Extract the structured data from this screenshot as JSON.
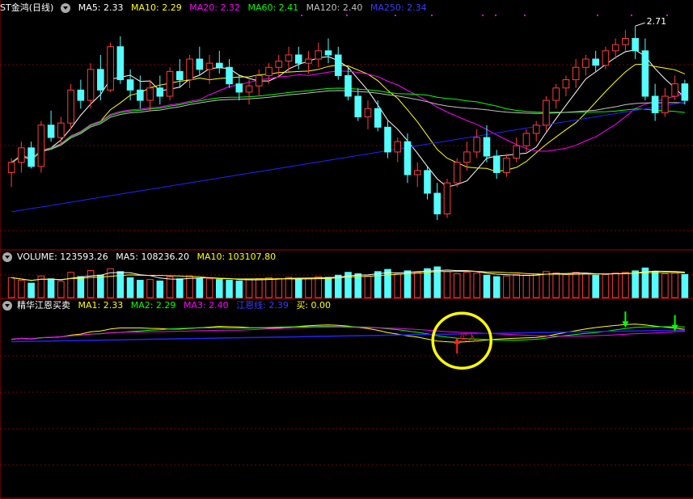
{
  "header_main": {
    "title": "ST金鸿(日线)",
    "ma5": "MA5: 2.33",
    "ma10": "MA10: 2.29",
    "ma20": "MA20: 2.32",
    "ma60": "MA60: 2.41",
    "ma120": "MA120: 2.40",
    "ma250": "MA250: 2.34"
  },
  "header_volume": {
    "volume": "VOLUME: 123593.26",
    "ma5": "MA5: 108236.20",
    "ma10": "MA10: 103107.80"
  },
  "header_indicator": {
    "name": "精华江恩买卖",
    "ma1": "MA1: 2.33",
    "ma2": "MA2: 2.29",
    "ma3": "MA3: 2.40",
    "gann": "江恩线: 2.39",
    "buy": "买: 0.00"
  },
  "colors": {
    "up": "#ff3c3c",
    "down": "#54fcfc",
    "ma5": "#ffffff",
    "ma10": "#ffff00",
    "ma20": "#ff00ff",
    "ma60": "#00ff00",
    "ma120": "#c0c0c0",
    "ma250": "#2222ff",
    "grid": "#7a0000",
    "highlight": "#ffff00"
  },
  "chart_data": [
    {
      "type": "candlestick",
      "panel": "price",
      "high_label": "2.71",
      "yrange": [
        1.75,
        2.8
      ],
      "candles": [
        [
          2.05,
          2.12,
          1.98,
          2.1
        ],
        [
          2.1,
          2.2,
          2.05,
          2.17
        ],
        [
          2.17,
          2.2,
          2.07,
          2.08
        ],
        [
          2.08,
          2.3,
          2.05,
          2.28
        ],
        [
          2.28,
          2.35,
          2.2,
          2.22
        ],
        [
          2.22,
          2.32,
          2.18,
          2.29
        ],
        [
          2.29,
          2.48,
          2.26,
          2.45
        ],
        [
          2.45,
          2.5,
          2.36,
          2.4
        ],
        [
          2.4,
          2.58,
          2.36,
          2.55
        ],
        [
          2.55,
          2.62,
          2.4,
          2.45
        ],
        [
          2.45,
          2.68,
          2.44,
          2.66
        ],
        [
          2.66,
          2.71,
          2.48,
          2.5
        ],
        [
          2.5,
          2.55,
          2.4,
          2.45
        ],
        [
          2.45,
          2.52,
          2.36,
          2.4
        ],
        [
          2.4,
          2.5,
          2.35,
          2.46
        ],
        [
          2.46,
          2.52,
          2.38,
          2.42
        ],
        [
          2.42,
          2.56,
          2.4,
          2.54
        ],
        [
          2.54,
          2.6,
          2.46,
          2.5
        ],
        [
          2.5,
          2.62,
          2.46,
          2.6
        ],
        [
          2.6,
          2.66,
          2.52,
          2.55
        ],
        [
          2.55,
          2.62,
          2.48,
          2.58
        ],
        [
          2.58,
          2.64,
          2.53,
          2.56
        ],
        [
          2.56,
          2.6,
          2.46,
          2.48
        ],
        [
          2.48,
          2.52,
          2.4,
          2.44
        ],
        [
          2.44,
          2.5,
          2.38,
          2.47
        ],
        [
          2.47,
          2.55,
          2.42,
          2.52
        ],
        [
          2.52,
          2.58,
          2.48,
          2.56
        ],
        [
          2.56,
          2.62,
          2.51,
          2.59
        ],
        [
          2.59,
          2.66,
          2.54,
          2.62
        ],
        [
          2.62,
          2.66,
          2.55,
          2.58
        ],
        [
          2.58,
          2.64,
          2.53,
          2.6
        ],
        [
          2.6,
          2.68,
          2.56,
          2.64
        ],
        [
          2.64,
          2.7,
          2.58,
          2.62
        ],
        [
          2.62,
          2.66,
          2.5,
          2.52
        ],
        [
          2.52,
          2.56,
          2.4,
          2.42
        ],
        [
          2.42,
          2.46,
          2.3,
          2.32
        ],
        [
          2.32,
          2.4,
          2.26,
          2.36
        ],
        [
          2.36,
          2.4,
          2.25,
          2.27
        ],
        [
          2.27,
          2.3,
          2.12,
          2.15
        ],
        [
          2.15,
          2.22,
          2.1,
          2.2
        ],
        [
          2.2,
          2.24,
          2.0,
          2.04
        ],
        [
          2.04,
          2.1,
          1.98,
          2.06
        ],
        [
          2.06,
          2.08,
          1.92,
          1.95
        ],
        [
          1.95,
          2.0,
          1.82,
          1.85
        ],
        [
          1.85,
          2.02,
          1.83,
          2.0
        ],
        [
          2.0,
          2.12,
          1.98,
          2.1
        ],
        [
          2.1,
          2.2,
          2.06,
          2.15
        ],
        [
          2.15,
          2.26,
          2.12,
          2.22
        ],
        [
          2.22,
          2.28,
          2.1,
          2.13
        ],
        [
          2.13,
          2.16,
          2.02,
          2.05
        ],
        [
          2.05,
          2.14,
          2.03,
          2.12
        ],
        [
          2.12,
          2.22,
          2.1,
          2.18
        ],
        [
          2.18,
          2.26,
          2.15,
          2.24
        ],
        [
          2.24,
          2.3,
          2.2,
          2.28
        ],
        [
          2.28,
          2.42,
          2.25,
          2.4
        ],
        [
          2.4,
          2.48,
          2.36,
          2.46
        ],
        [
          2.46,
          2.52,
          2.42,
          2.5
        ],
        [
          2.5,
          2.6,
          2.46,
          2.56
        ],
        [
          2.56,
          2.62,
          2.52,
          2.6
        ],
        [
          2.6,
          2.64,
          2.54,
          2.57
        ],
        [
          2.57,
          2.66,
          2.55,
          2.64
        ],
        [
          2.64,
          2.7,
          2.6,
          2.67
        ],
        [
          2.67,
          2.74,
          2.64,
          2.7
        ],
        [
          2.7,
          2.76,
          2.6,
          2.64
        ],
        [
          2.64,
          2.7,
          2.4,
          2.42
        ],
        [
          2.42,
          2.48,
          2.3,
          2.34
        ],
        [
          2.34,
          2.46,
          2.32,
          2.42
        ],
        [
          2.42,
          2.52,
          2.4,
          2.48
        ],
        [
          2.48,
          2.5,
          2.38,
          2.4
        ]
      ],
      "volume": [
        55,
        48,
        40,
        60,
        52,
        45,
        70,
        58,
        75,
        62,
        80,
        72,
        55,
        48,
        50,
        46,
        58,
        52,
        60,
        54,
        52,
        50,
        48,
        46,
        50,
        52,
        55,
        53,
        56,
        52,
        54,
        58,
        56,
        62,
        70,
        66,
        60,
        72,
        78,
        65,
        74,
        70,
        80,
        85,
        72,
        66,
        70,
        68,
        62,
        58,
        60,
        64,
        62,
        66,
        72,
        68,
        64,
        70,
        66,
        62,
        64,
        68,
        70,
        74,
        82,
        72,
        66,
        68,
        64
      ]
    }
  ]
}
